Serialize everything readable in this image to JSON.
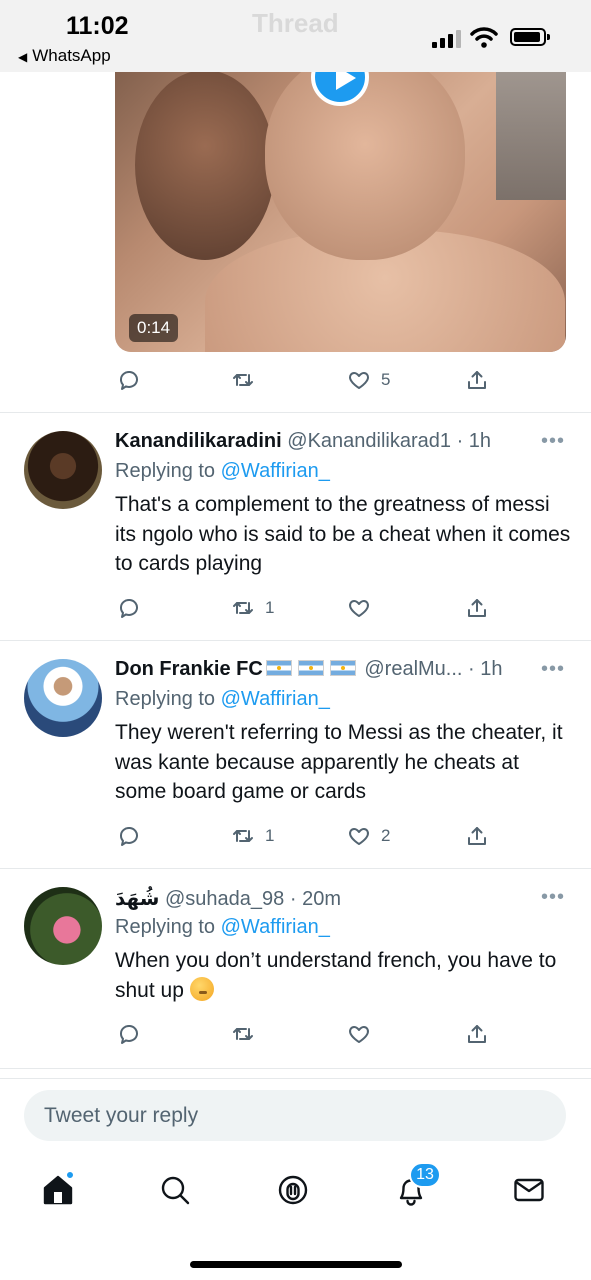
{
  "status_bar": {
    "time": "11:02",
    "back_label": "WhatsApp",
    "ghost_title": "Thread"
  },
  "video": {
    "duration": "0:14"
  },
  "main_tweet_actions": {
    "like_count": "5"
  },
  "replies": [
    {
      "display_name": "Kanandilikaradini",
      "handle": "@Kanandilikarad1",
      "time": "· 1h",
      "replying_label": "Replying to",
      "replying_handle": "@Waffirian_",
      "text": "That's a complement to the greatness of messi its ngolo who is said to be a cheat when it comes to cards playing",
      "retweets": "1",
      "likes": ""
    },
    {
      "display_name": "Don Frankie FC",
      "handle": "@realMu...",
      "time": "· 1h",
      "replying_label": "Replying to",
      "replying_handle": "@Waffirian_",
      "text": "They weren't referring to Messi as the cheater, it was kante because apparently he cheats at some board game or cards",
      "retweets": "1",
      "likes": "2"
    },
    {
      "display_name": "شُهَدَ",
      "handle": "@suhada_98",
      "time": "· 20m",
      "replying_label": "Replying to",
      "replying_handle": "@Waffirian_",
      "text": "When you don’t understand french, you have to shut up",
      "retweets": "",
      "likes": ""
    }
  ],
  "more_glyph": "•••",
  "reply_box": {
    "placeholder": "Tweet your reply"
  },
  "tabbar": {
    "notifications_badge": "13"
  },
  "colors": {
    "accent": "#1d9bf0",
    "secondary_text": "#536471",
    "primary_text": "#0f1419"
  }
}
